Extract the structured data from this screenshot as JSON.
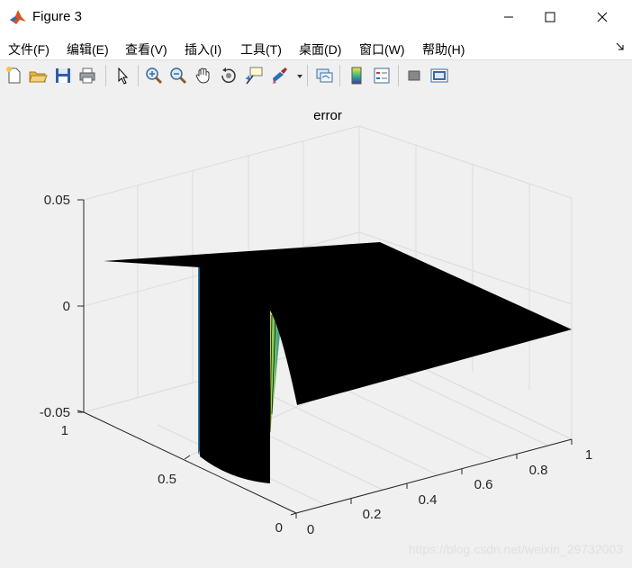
{
  "window": {
    "title": "Figure 3"
  },
  "menu": [
    "文件(F)",
    "编辑(E)",
    "查看(V)",
    "插入(I)",
    "工具(T)",
    "桌面(D)",
    "窗口(W)",
    "帮助(H)"
  ],
  "toolbar": [
    {
      "name": "new-figure-icon"
    },
    {
      "name": "open-file-icon"
    },
    {
      "name": "save-icon"
    },
    {
      "name": "print-icon"
    },
    {
      "name": "edit-plot-arrow-icon"
    },
    {
      "name": "zoom-in-icon"
    },
    {
      "name": "zoom-out-icon"
    },
    {
      "name": "pan-hand-icon"
    },
    {
      "name": "rotate-3d-icon"
    },
    {
      "name": "data-cursor-icon"
    },
    {
      "name": "brush-icon"
    },
    {
      "name": "brush-dropdown-icon"
    },
    {
      "name": "link-plot-icon"
    },
    {
      "name": "insert-colorbar-icon"
    },
    {
      "name": "insert-legend-icon"
    },
    {
      "name": "hide-plot-tools-icon"
    },
    {
      "name": "show-plot-tools-icon"
    }
  ],
  "plot": {
    "title": "error",
    "z_ticks": [
      "0.05",
      "0",
      "-0.05"
    ],
    "y_ticks": [
      "1",
      "0.5",
      "0"
    ],
    "x_ticks": [
      "0",
      "0.2",
      "0.4",
      "0.6",
      "0.8",
      "1"
    ]
  },
  "watermark": "https://blog.csdn.net/weixin_29732003"
}
